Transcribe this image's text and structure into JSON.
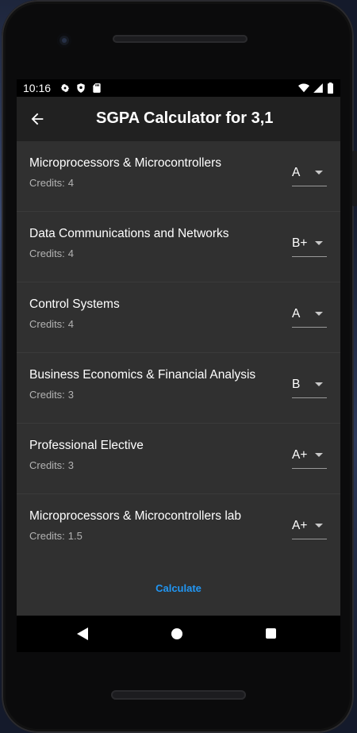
{
  "status": {
    "time": "10:16",
    "icons_left": [
      "gear-icon",
      "shield-icon",
      "sd-card-icon"
    ],
    "icons_right": [
      "wifi-icon",
      "signal-icon",
      "battery-icon"
    ]
  },
  "appbar": {
    "title": "SGPA Calculator for 3,1",
    "back_icon": "arrow-left-icon"
  },
  "credits_label": "Credits:",
  "subjects": [
    {
      "name": "Microprocessors & Microcontrollers",
      "credits": "4",
      "grade": "A"
    },
    {
      "name": "Data Communications and Networks",
      "credits": "4",
      "grade": "B+"
    },
    {
      "name": "Control Systems",
      "credits": "4",
      "grade": "A"
    },
    {
      "name": "Business Economics & Financial Analysis",
      "credits": "3",
      "grade": "B"
    },
    {
      "name": "Professional Elective",
      "credits": "3",
      "grade": "A+"
    },
    {
      "name": "Microprocessors & Microcontrollers lab",
      "credits": "1.5",
      "grade": "A+"
    }
  ],
  "footer": {
    "calculate_label": "Calculate"
  },
  "colors": {
    "accent": "#2196f3",
    "appbar": "#212121",
    "list_bg": "#303030"
  }
}
